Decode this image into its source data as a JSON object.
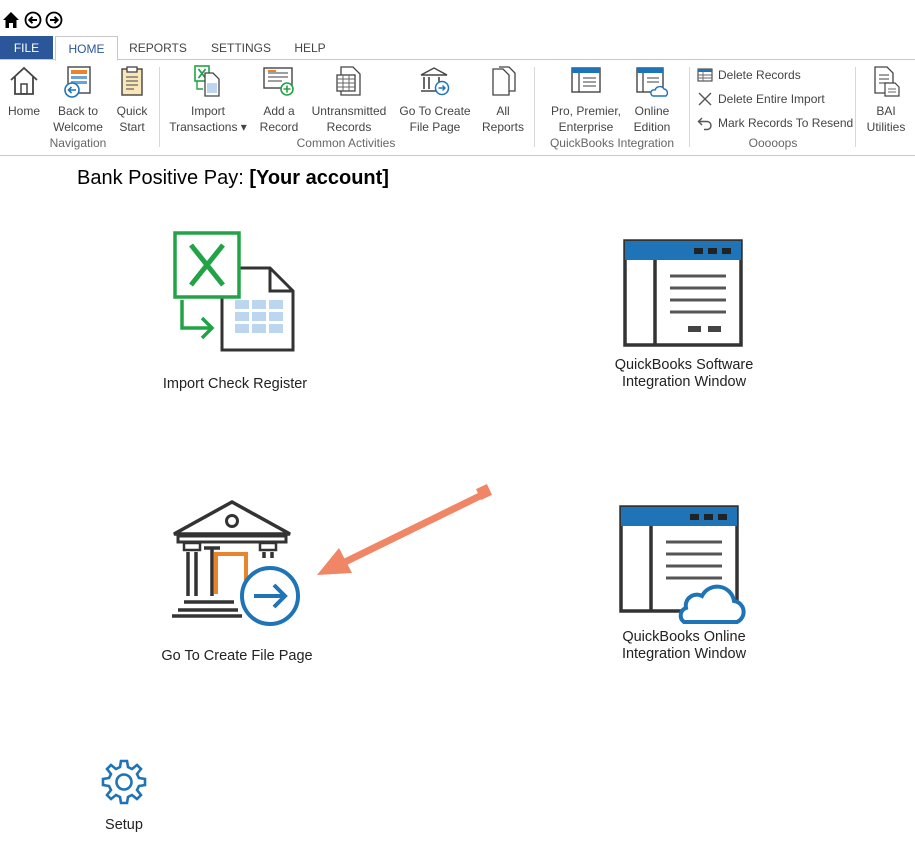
{
  "tabs": {
    "file": "FILE",
    "home": "HOME",
    "reports": "REPORTS",
    "settings": "SETTINGS",
    "help": "HELP"
  },
  "ribbon": {
    "navigation": {
      "group_label": "Navigation",
      "home": "Home",
      "back_to_welcome": "Back to\nWelcome",
      "quick_start": "Quick\nStart"
    },
    "common": {
      "group_label": "Common Activities",
      "import_transactions": "Import\nTransactions ▾",
      "add_record": "Add a\nRecord",
      "untransmitted_records": "Untransmitted\nRecords",
      "go_to_create_file_page": "Go To Create\nFile Page",
      "all_reports": "All\nReports"
    },
    "quickbooks": {
      "group_label": "QuickBooks Integration",
      "pro_premier": "Pro, Premier,\nEnterprise",
      "online_edition": "Online\nEdition"
    },
    "oops": {
      "group_label": "Ooooops",
      "delete_records": "Delete Records",
      "delete_entire_import": "Delete Entire Import",
      "mark_records_to_resend": "Mark Records To Resend"
    },
    "bai": {
      "bai_utilities": "BAI\nUtilities"
    }
  },
  "main": {
    "title_prefix": "Bank Positive Pay: ",
    "title_account": "[Your account]",
    "tiles": {
      "import_check_register": "Import Check Register",
      "qb_software": "QuickBooks Software\nIntegration Window",
      "go_to_create_file_page": "Go To Create File Page",
      "qb_online": "QuickBooks Online\nIntegration Window",
      "setup": "Setup"
    }
  },
  "colors": {
    "file_tab": "#2b579a",
    "excel_green": "#21a346",
    "window_blue": "#1f73b7",
    "arrow_orange": "#f08665",
    "door_orange": "#e8842b"
  }
}
